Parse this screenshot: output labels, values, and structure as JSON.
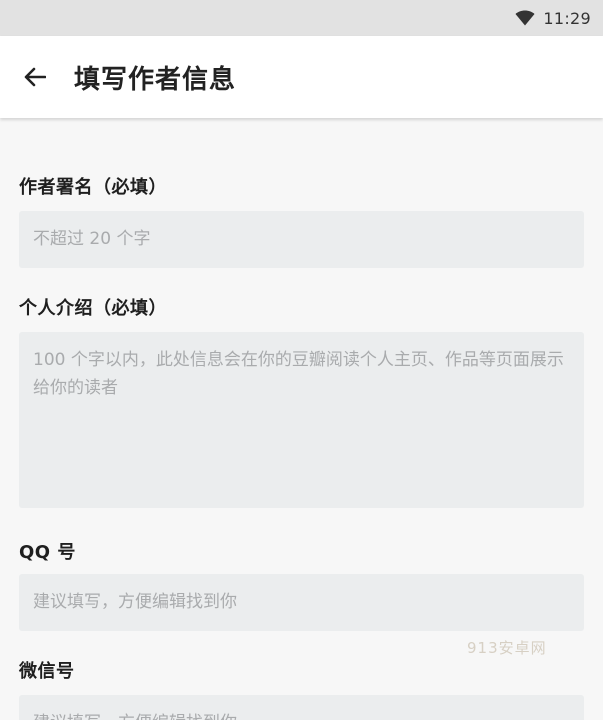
{
  "status_bar": {
    "time": "11:29",
    "icon": "wifi-icon"
  },
  "app_bar": {
    "back_icon": "arrow-left-icon",
    "title": "填写作者信息"
  },
  "form": {
    "pen_name": {
      "label": "作者署名（必填）",
      "placeholder": "不超过 20 个字"
    },
    "bio": {
      "label": "个人介绍（必填）",
      "placeholder": "100 个字以内，此处信息会在你的豆瓣阅读个人主页、作品等页面展示给你的读者"
    },
    "qq": {
      "label": "QQ 号",
      "placeholder": "建议填写，方便编辑找到你"
    },
    "wechat": {
      "label": "微信号",
      "placeholder": "建议填写，方便编辑找到你"
    }
  },
  "watermark": "913安卓网",
  "colors": {
    "status_bar_bg": "#e2e2e2",
    "app_bar_bg": "#ffffff",
    "page_bg": "#f7f7f7",
    "input_bg": "#ebedee",
    "placeholder_text": "#a9abad"
  }
}
